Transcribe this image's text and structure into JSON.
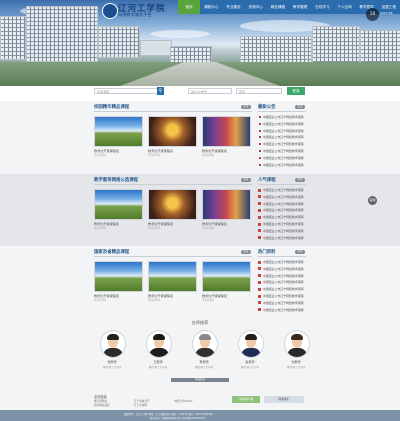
{
  "header": {
    "logo_title": "辽河工学院",
    "logo_subtitle": "网络教学服务平台",
    "nav": [
      "首页",
      "课程中心",
      "专业建设",
      "资源中心",
      "精品课程",
      "教学管理",
      "在线学习",
      "个人空间",
      "教学督导",
      "加盟工程"
    ],
    "active_nav_index": 0,
    "date_badge": "10",
    "date_text": "2015-05",
    "hero_dots": 5
  },
  "search": {
    "placeholder": "搜索课程",
    "username_placeholder": "用户名/学号",
    "password_placeholder": "密码",
    "login_label": "登录"
  },
  "sections": [
    {
      "title": "校园精华精品课程",
      "more": "更多",
      "cards": [
        {
          "caption": "教务处开课课程组",
          "meta": "学分6学时"
        },
        {
          "caption": "教务处开课课程组",
          "meta": "学分6学时"
        },
        {
          "caption": "教务处开课课程组",
          "meta": "学分6学时"
        }
      ],
      "side_title": "最新公告",
      "side_more": "更多",
      "side_items": [
        "中国结业公布辽宁网络教学课程",
        "中国结业公布辽宁网络教学课程",
        "中国结业公布辽宁网络教学课程",
        "中国结业公布辽宁网络教学课程",
        "中国结业公布辽宁网络教学课程",
        "中国结业公布辽宁网络教学课程",
        "中国结业公布辽宁网络教学课程",
        "中国结业公布辽宁网络教学课程"
      ]
    },
    {
      "title": "教学督导网络公选课程",
      "more": "更多",
      "cards": [
        {
          "caption": "教务处开课课程组",
          "meta": "学分6学时"
        },
        {
          "caption": "教务处开课课程组",
          "meta": "学分6学时"
        },
        {
          "caption": "教务处开课课程组",
          "meta": "学分6学时"
        }
      ],
      "side_title": "人气课程",
      "side_more": "更多",
      "side_items": [
        "中国结业公布辽宁网络教学课程",
        "中国结业公布辽宁网络教学课程",
        "中国结业公布辽宁网络教学课程",
        "中国结业公布辽宁网络教学课程",
        "中国结业公布辽宁网络教学课程",
        "中国结业公布辽宁网络教学课程",
        "中国结业公布辽宁网络教学课程",
        "中国结业公布辽宁网络教学课程"
      ]
    },
    {
      "title": "国家及省精品课程",
      "more": "更多",
      "cards": [
        {
          "caption": "教务处开课课程组",
          "meta": "学分6学时"
        },
        {
          "caption": "教务处开课课程组",
          "meta": "学分6学时"
        },
        {
          "caption": "教务处开课课程组",
          "meta": "学分6学时"
        }
      ],
      "side_title": "热门资料",
      "side_more": "更多",
      "side_items": [
        "中国结业公布辽宁网络教学课程",
        "中国结业公布辽宁网络教学课程",
        "中国结业公布辽宁网络教学课程",
        "中国结业公布辽宁网络教学课程",
        "中国结业公布辽宁网络教学课程",
        "中国结业公布辽宁网络教学课程",
        "中国结业公布辽宁网络教学课程",
        "中国结业公布辽宁网络教学课程"
      ]
    }
  ],
  "teachers": {
    "title": "名师推荐",
    "more": "查看更多",
    "items": [
      {
        "name": "张老师",
        "sub": "教授/博士生导师"
      },
      {
        "name": "王老师",
        "sub": "教授/博士生导师"
      },
      {
        "name": "李老师",
        "sub": "教授/博士生导师"
      },
      {
        "name": "赵老师",
        "sub": "教授/博士生导师"
      },
      {
        "name": "刘老师",
        "sub": "教授/博士生导师"
      }
    ]
  },
  "float_buttons": [
    "客服",
    "顶部"
  ],
  "footer": {
    "links_title": "友情链接",
    "links": [
      "教育部网站",
      "辽宁省教育厅",
      "中国大学MOOC",
      "国家精品课程",
      "辽宁高校网"
    ],
    "app_button": "手机客户端",
    "contact_button": "联系我们",
    "line1": "版权所有：辽河工学院 地址：辽宁省盘锦市 邮编：124010 电话：0427-0000000",
    "line2": "技术支持：网络教学服务平台 辽ICP备00000000号"
  },
  "colors": {
    "nav_bg": "#2a6cad",
    "nav_active": "#5aa43c",
    "accent": "#2a5b8f",
    "footer_bg": "#7f93a8"
  }
}
